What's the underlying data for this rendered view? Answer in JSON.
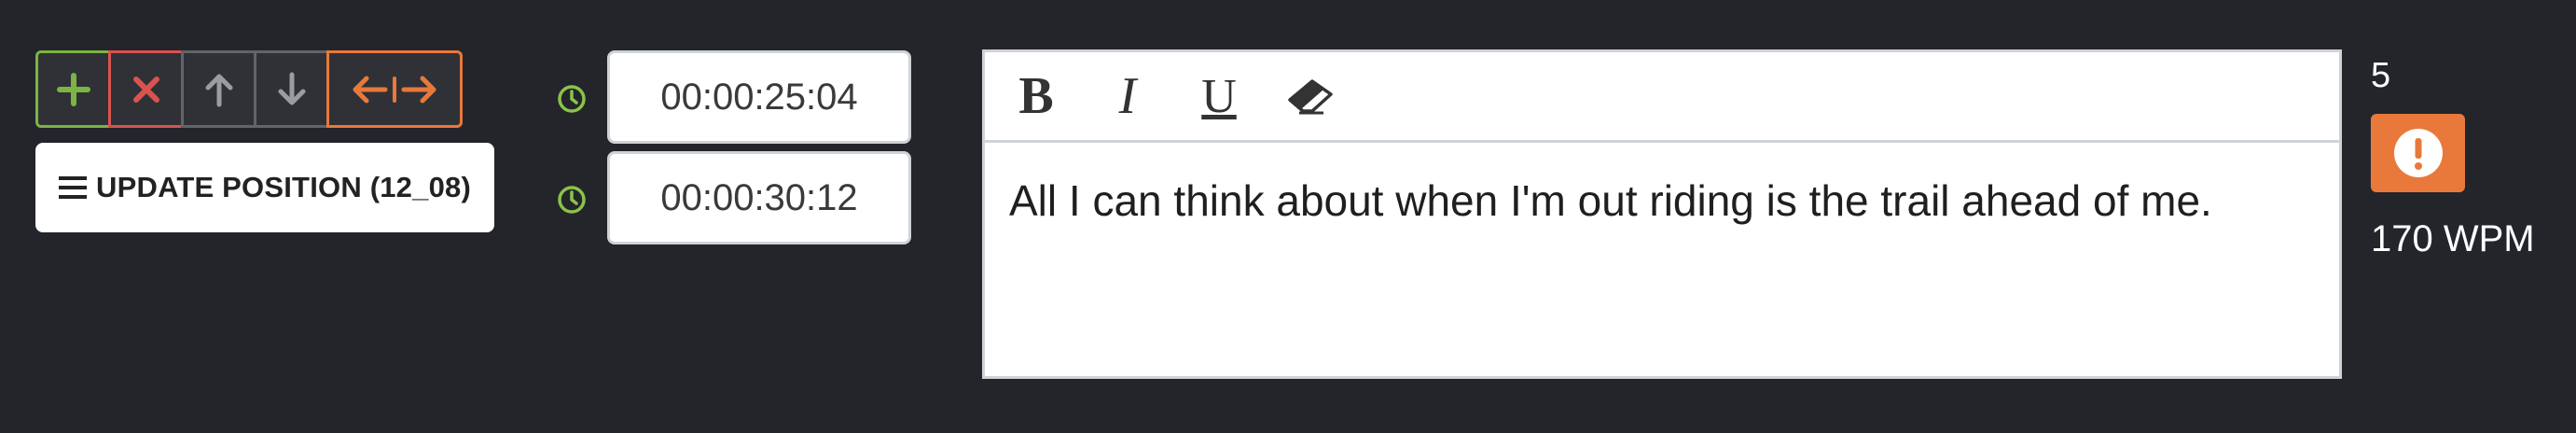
{
  "controls": {
    "update_position_label": "UPDATE POSITION (12_08)",
    "colors": {
      "add": "#7cb342",
      "delete": "#d9534f",
      "swap": "#e8793b",
      "neutral": "#626469"
    }
  },
  "timing": {
    "start_time": "00:00:25:04",
    "end_time": "00:00:30:12",
    "clock_color": "#8bc34a"
  },
  "editor": {
    "tools": [
      "bold-icon",
      "italic-icon",
      "underline-icon",
      "eraser-icon"
    ],
    "bold_glyph": "B",
    "italic_glyph": "I",
    "underline_glyph": "U",
    "text": "All I can think about when I'm out riding is the trail ahead of me."
  },
  "stats": {
    "count": "5",
    "wpm": "170 WPM",
    "warning_color": "#e8793b"
  }
}
